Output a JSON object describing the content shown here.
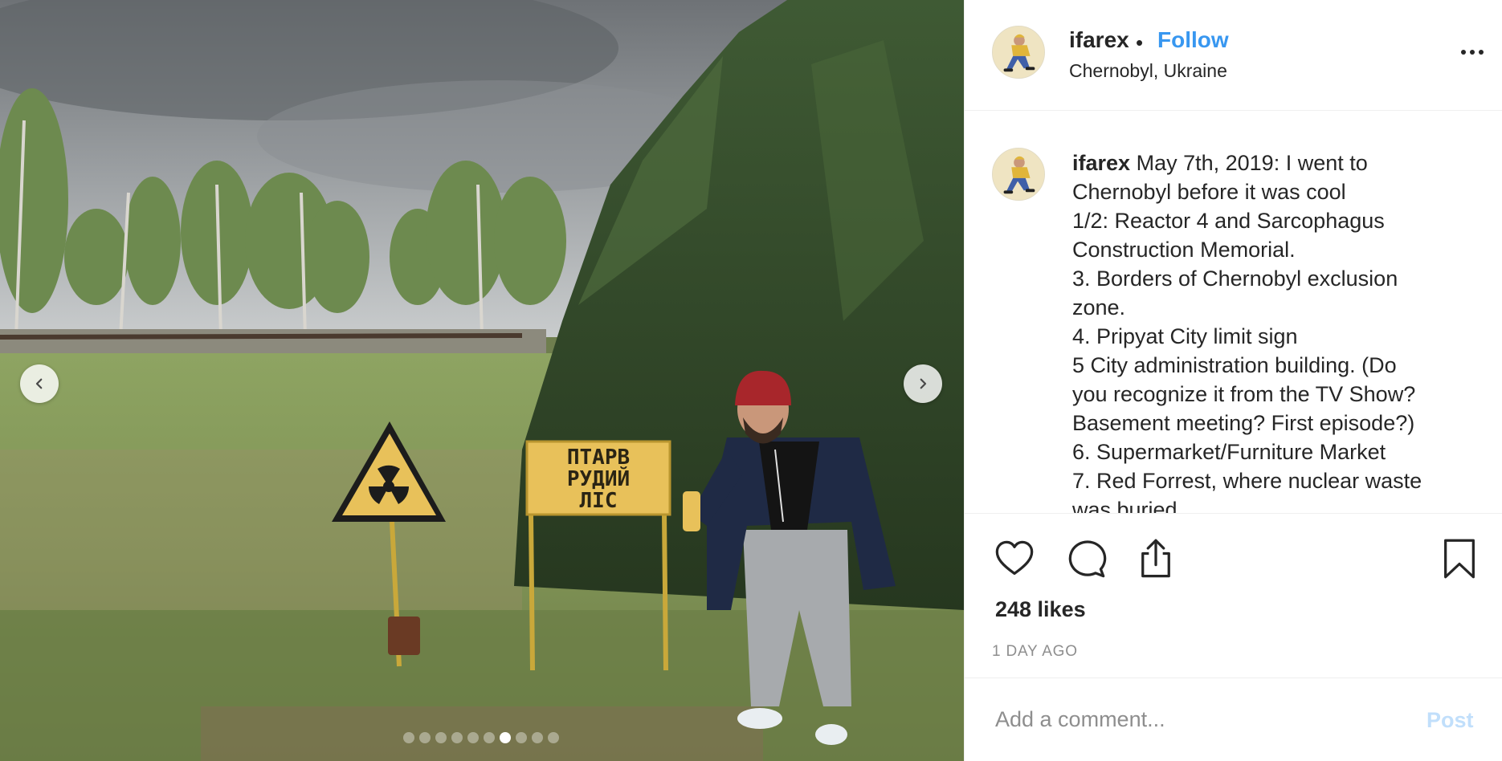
{
  "post": {
    "username": "ifarex",
    "separator": "•",
    "follow_label": "Follow",
    "location": "Chernobyl, Ukraine",
    "photo": {
      "sign_text_lines": [
        "ПТАРВ",
        "РУДИЙ",
        "ЛІС"
      ],
      "carousel": {
        "total_slides": 10,
        "active_index": 6
      }
    },
    "caption": {
      "username": "ifarex",
      "lines": [
        "May 7th, 2019: I went to",
        "Chernobyl before it was cool",
        "1/2: Reactor 4 and Sarcophagus",
        "Construction Memorial.",
        "3. Borders of Chernobyl exclusion",
        "zone.",
        "4. Pripyat City limit sign",
        "5 City administration building. (Do",
        "you recognize it from the TV Show?",
        "Basement meeting? First episode?)",
        "6. Supermarket/Furniture Market",
        "7. Red Forrest, where nuclear waste",
        "was buried"
      ]
    },
    "likes": "248 likes",
    "timestamp": "1 DAY AGO",
    "comment": {
      "placeholder": "Add a comment...",
      "post_label": "Post"
    }
  },
  "colors": {
    "follow": "#3897f0",
    "post_disabled": "#c1dffb",
    "muted_text": "#8e8e8e",
    "sign_yellow": "#e8c15a"
  },
  "icons": [
    "heart-icon",
    "comment-icon",
    "share-icon",
    "bookmark-icon",
    "chevron-left-icon",
    "chevron-right-icon",
    "more-options-icon"
  ]
}
